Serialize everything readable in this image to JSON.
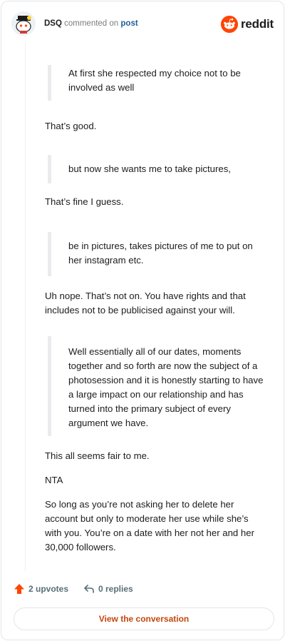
{
  "header": {
    "username": "DSQ",
    "action_text": "commented on",
    "post_link": "post",
    "brand_word": "reddit"
  },
  "comment": {
    "blocks": [
      {
        "type": "quote",
        "text": "At first she respected my choice not to be involved as well"
      },
      {
        "type": "para",
        "text": "That’s good."
      },
      {
        "type": "quote",
        "text": "but now she wants me to take pictures,"
      },
      {
        "type": "para",
        "text": "That’s fine I guess."
      },
      {
        "type": "quote",
        "text": "be in pictures, takes pictures of me to put on her instagram etc."
      },
      {
        "type": "para",
        "text": "Uh nope. That’s not on. You have rights and that includes not to be publicised against your will."
      },
      {
        "type": "quote",
        "text": "Well essentially all of our dates, moments together and so forth are now the subject of a photosession and it is honestly starting to have a large impact on our relationship and has turned into the primary subject of every argument we have."
      },
      {
        "type": "para",
        "text": "This all seems fair to me."
      },
      {
        "type": "para",
        "text": "NTA"
      },
      {
        "type": "para",
        "text": "So long as you’re not asking her to delete her account but only to moderate her use while she’s with you. You’re on a date with her not her and her 30,000 followers."
      }
    ]
  },
  "footer": {
    "upvotes_label": "2 upvotes",
    "replies_label": "0 replies",
    "view_button": "View the conversation"
  },
  "colors": {
    "brand": "#ff4500",
    "link": "#1d5f9a",
    "view_button_text": "#c4470f",
    "muted": "#576f76"
  }
}
